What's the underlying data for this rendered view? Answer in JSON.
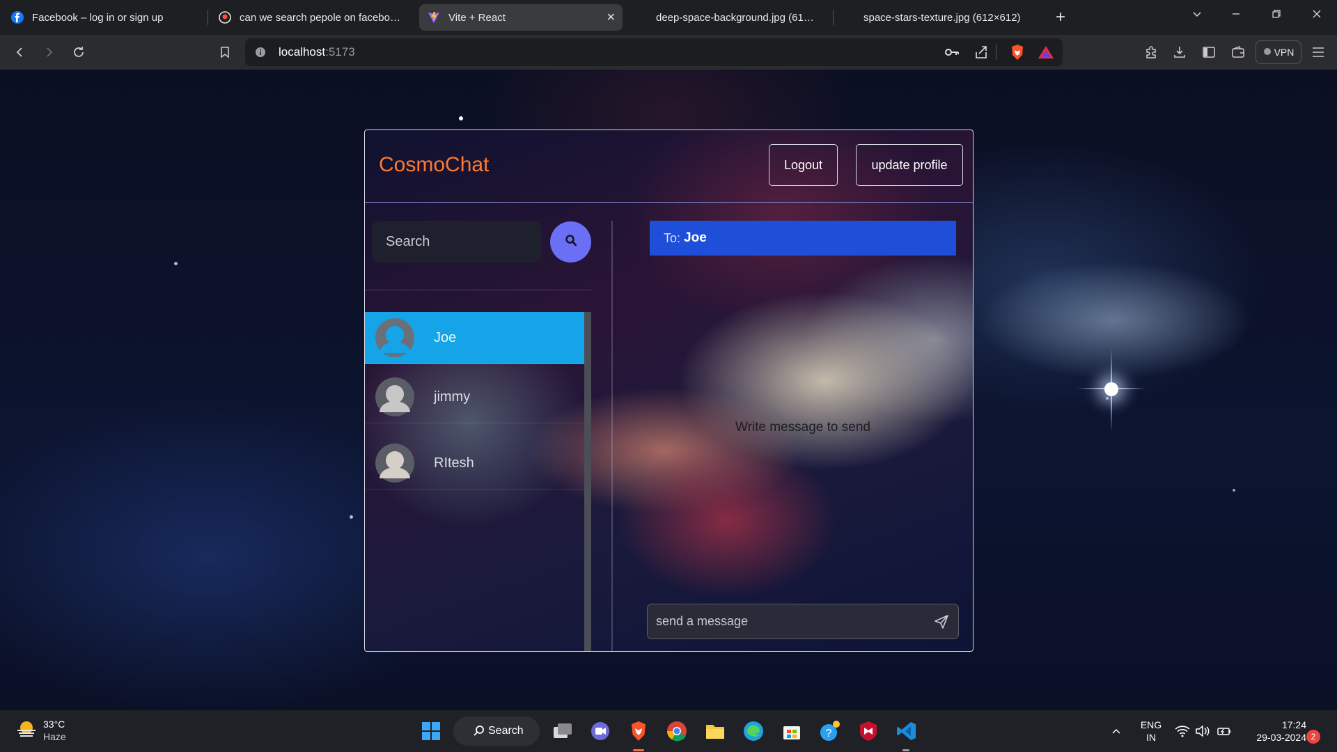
{
  "browser": {
    "tabs": [
      {
        "title": "Facebook – log in or sign up",
        "active": false
      },
      {
        "title": "can we search pepole on facebook t",
        "active": false
      },
      {
        "title": "Vite + React",
        "active": true
      },
      {
        "title": "deep-space-background.jpg (612×4",
        "active": false
      },
      {
        "title": "space-stars-texture.jpg (612×612)",
        "active": false
      }
    ],
    "new_tab": "+",
    "url_host": "localhost",
    "url_port": ":5173",
    "vpn_label": "VPN"
  },
  "app": {
    "brand": "CosmoChat",
    "brand_color": "#ff7a2e",
    "logout_label": "Logout",
    "update_profile_label": "update profile",
    "search_placeholder": "Search",
    "users": [
      {
        "name": "Joe",
        "active": true
      },
      {
        "name": "jimmy",
        "active": false
      },
      {
        "name": "RItesh",
        "active": false
      }
    ],
    "to_prefix": "To:",
    "to_name": "Joe",
    "empty_message": "Write message to send",
    "message_placeholder": "send a message"
  },
  "taskbar": {
    "weather_temp": "33°C",
    "weather_condition": "Haze",
    "search_label": "Search",
    "lang_top": "ENG",
    "lang_bottom": "IN",
    "time": "17:24",
    "date": "29-03-2024",
    "notification_count": "2"
  }
}
